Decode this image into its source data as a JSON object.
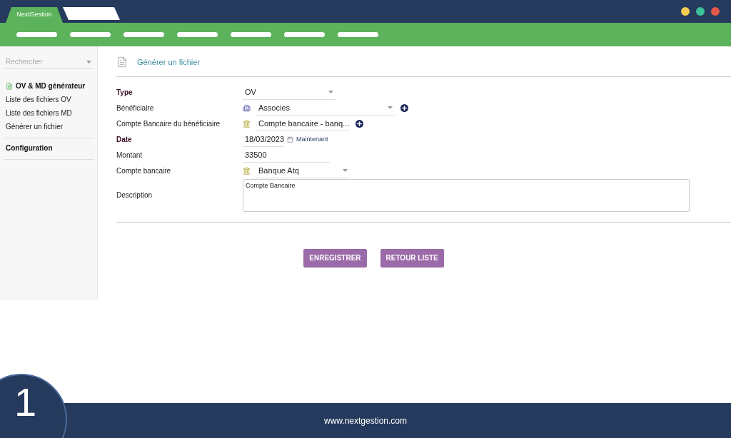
{
  "app_tab": {
    "label": "NextGestion"
  },
  "sidebar": {
    "search": {
      "placeholder": "Rechercher"
    },
    "sections": [
      {
        "title": "OV & MD générateur",
        "items": [
          {
            "label": "Liste des fichiers OV"
          },
          {
            "label": "Liste des fichiers MD"
          },
          {
            "label": "Générer un fichier"
          }
        ]
      },
      {
        "title": "Configuration"
      }
    ]
  },
  "page": {
    "title": "Générer un fichier"
  },
  "form": {
    "rows": [
      {
        "label": "Type",
        "required": true,
        "kind": "select",
        "value": "OV",
        "addable": false
      },
      {
        "label": "Bénéficiaire",
        "required": false,
        "kind": "entity-select",
        "value": "Associes",
        "addable": true
      },
      {
        "label": "Compte Bancaire du bénéficiaire",
        "required": false,
        "kind": "bank-select",
        "value": "Compte bancaire - banq...",
        "addable": true
      },
      {
        "label": "Date",
        "required": true,
        "kind": "date",
        "value": "18/03/2023",
        "action": "Maintenant"
      },
      {
        "label": "Montant",
        "required": false,
        "kind": "text",
        "value": "33500"
      },
      {
        "label": "Compte bancaire",
        "required": false,
        "kind": "bank-select",
        "value": "Banque Atq",
        "addable": false
      },
      {
        "label": "Description",
        "required": false,
        "kind": "textarea",
        "value": "Compte Bancaire"
      }
    ]
  },
  "buttons": [
    {
      "label": "ENREGISTRER"
    },
    {
      "label": "RETOUR LISTE"
    }
  ],
  "footer": {
    "step": "1",
    "url": "www.nextgestion.com"
  }
}
